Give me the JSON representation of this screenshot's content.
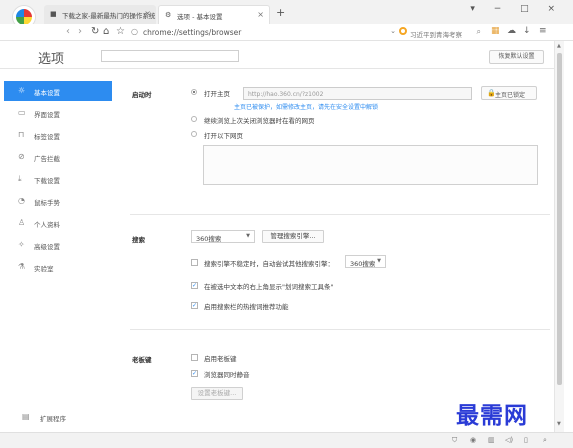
{
  "browser": {
    "tabs": [
      {
        "title": "下载之家-最新最热门的操作系统"
      },
      {
        "title": "选项 - 基本设置"
      }
    ],
    "address": "chrome://settings/browser",
    "search_placeholder": "习近平到青海考察",
    "window_controls": "▾ − □ ×"
  },
  "settings": {
    "title": "选项",
    "search_placeholder": "",
    "reset_label": "恢复默认设置"
  },
  "sidebar": {
    "items": [
      {
        "label": "基本设置",
        "icon": "gear-icon"
      },
      {
        "label": "界面设置",
        "icon": "window-icon"
      },
      {
        "label": "标签设置",
        "icon": "tab-icon"
      },
      {
        "label": "广告拦截",
        "icon": "block-icon"
      },
      {
        "label": "下载设置",
        "icon": "download-icon"
      },
      {
        "label": "鼠标手势",
        "icon": "mouse-icon"
      },
      {
        "label": "个人资料",
        "icon": "person-icon"
      },
      {
        "label": "高级设置",
        "icon": "advanced-icon"
      },
      {
        "label": "实验室",
        "icon": "lab-icon"
      }
    ],
    "extension_label": "扩展程序"
  },
  "startup": {
    "label": "启动时",
    "options": [
      {
        "label": "打开主页",
        "checked": true
      },
      {
        "label": "继续浏览上次关闭浏览器时在看的网页",
        "checked": false
      },
      {
        "label": "打开以下网页",
        "checked": false
      }
    ],
    "homepage_url": "http://hao.360.cn/?z1002",
    "lock_label": "主页已锁定",
    "hint": "主页已被保护，如需修改主页，请先在安全设置中解锁"
  },
  "search": {
    "label": "搜索",
    "engine": "360搜索",
    "manage_label": "管理搜索引擎...",
    "options": [
      {
        "label": "搜索引擎不稳定时，自动尝试其他搜索引擎：",
        "checked": false,
        "engine": "360搜索"
      },
      {
        "label": "在被选中文本的右上角显示\"划词搜索工具条\"",
        "checked": true
      },
      {
        "label": "启用搜索栏的热搜词推荐功能",
        "checked": true
      }
    ]
  },
  "boss_key": {
    "label": "老板键",
    "options": [
      {
        "label": "启用老板键",
        "checked": false
      },
      {
        "label": "浏览器同时静音",
        "checked": true
      }
    ],
    "set_label": "设置老板键..."
  },
  "watermark": "最需网"
}
